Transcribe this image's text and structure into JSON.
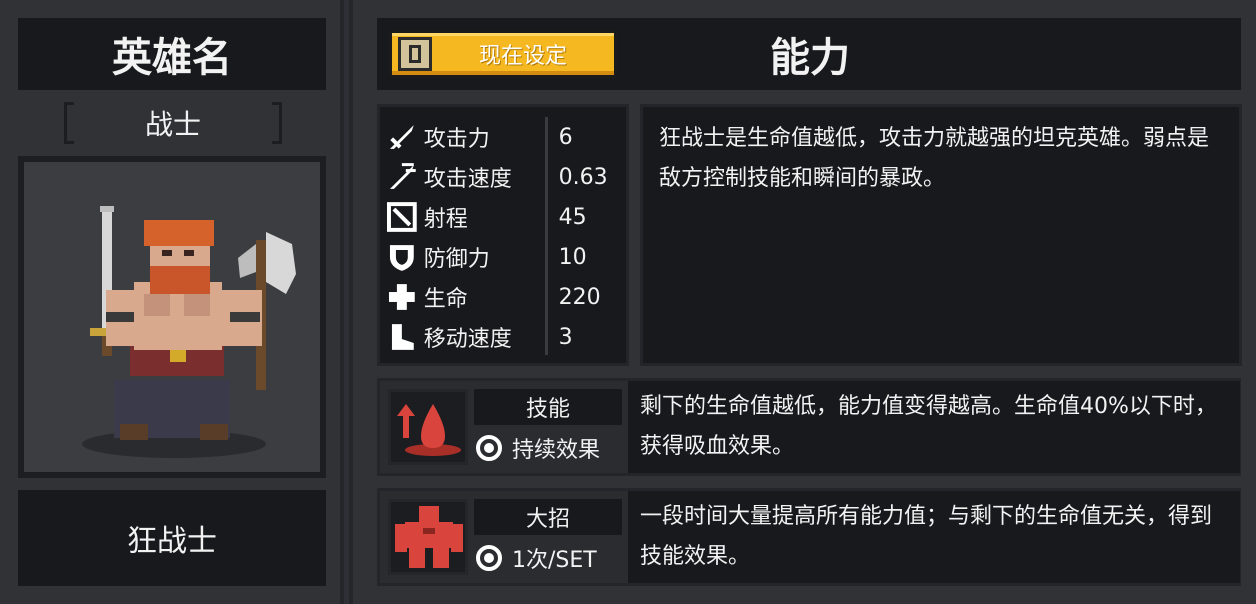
{
  "hero": {
    "title": "英雄名",
    "class": "战士",
    "name": "狂战士"
  },
  "header": {
    "set_button": "现在设定",
    "set_key": "D",
    "ability_title": "能力"
  },
  "stats": [
    {
      "icon": "sword-icon",
      "label": "攻击力",
      "value": "6"
    },
    {
      "icon": "fast-sword-icon",
      "label": "攻击速度",
      "value": "0.63"
    },
    {
      "icon": "range-icon",
      "label": "射程",
      "value": "45"
    },
    {
      "icon": "shield-icon",
      "label": "防御力",
      "value": "10"
    },
    {
      "icon": "health-cross-icon",
      "label": "生命",
      "value": "220"
    },
    {
      "icon": "boot-icon",
      "label": "移动速度",
      "value": "3"
    }
  ],
  "description": "狂战士是生命值越低，攻击力就越强的坦克英雄。弱点是敌方控制技能和瞬间的暴政。",
  "skill": {
    "label": "技能",
    "type": "持续效果",
    "text": "剩下的生命值越低，能力值变得越高。生命值40%以下时，获得吸血效果。"
  },
  "ultimate": {
    "label": "大招",
    "type": "1次/SET",
    "text": "一段时间大量提高所有能力值；与剩下的生命值无关，得到技能效果。"
  },
  "colors": {
    "accent": "#f5b820",
    "skill_red": "#d9443c",
    "panel": "#18191c"
  }
}
